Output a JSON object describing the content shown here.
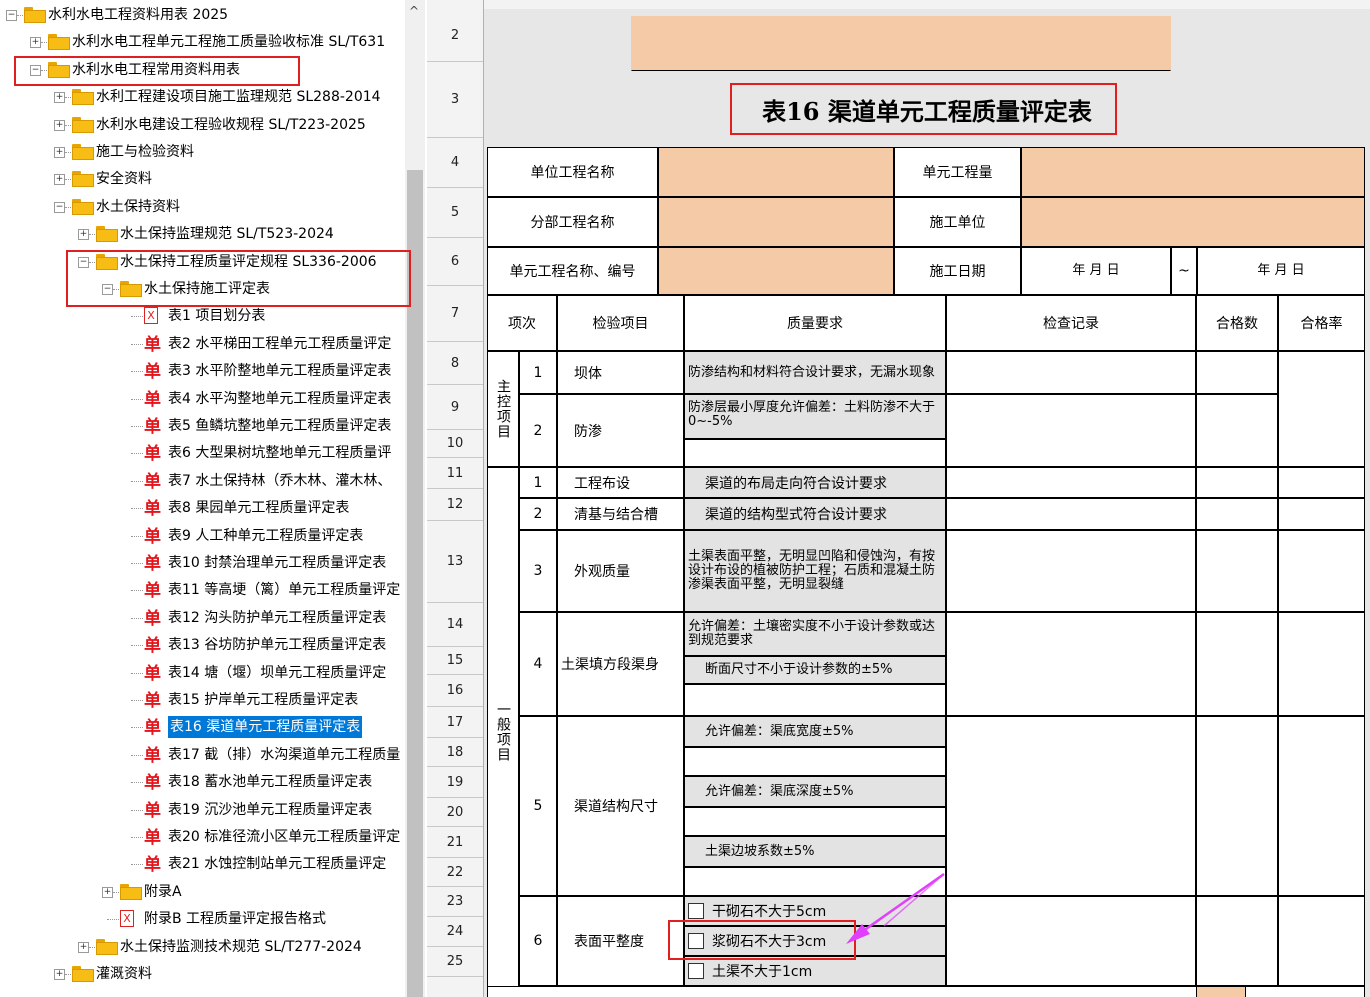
{
  "tree": {
    "items": [
      {
        "label": "水利水电工程资料用表 2025",
        "icon": "folder-icon",
        "expander": "−"
      },
      {
        "label": "水利水电工程单元工程施工质量验收标准 SL/T631",
        "icon": "folder-icon",
        "expander": "+"
      },
      {
        "label": "水利水电工程常用资料用表",
        "icon": "folder-icon",
        "expander": "−"
      },
      {
        "label": "水利工程建设项目施工监理规范 SL288-2014",
        "icon": "folder-icon",
        "expander": "+"
      },
      {
        "label": "水利水电建设工程验收规程 SL/T223-2025",
        "icon": "folder-icon",
        "expander": "+"
      },
      {
        "label": "施工与检验资料",
        "icon": "folder-icon",
        "expander": "+"
      },
      {
        "label": "安全资料",
        "icon": "folder-icon",
        "expander": "+"
      },
      {
        "label": "水土保持资料",
        "icon": "folder-icon",
        "expander": "−"
      },
      {
        "label": "水土保持监理规范 SL/T523-2024",
        "icon": "folder-icon",
        "expander": "+"
      },
      {
        "label": "水土保持工程质量评定规程 SL336-2006",
        "icon": "folder-icon",
        "expander": "−"
      },
      {
        "label": "水土保持施工评定表",
        "icon": "folder-icon",
        "expander": "−"
      },
      {
        "label": "表1 项目划分表",
        "icon": "excel-doc-icon",
        "glyph": "X"
      },
      {
        "label": "表2 水平梯田工程单元工程质量评定",
        "icon": "single-form-icon",
        "glyph": "单"
      },
      {
        "label": "表3 水平阶整地单元工程质量评定表",
        "icon": "single-form-icon",
        "glyph": "单"
      },
      {
        "label": "表4 水平沟整地单元工程质量评定表",
        "icon": "single-form-icon",
        "glyph": "单"
      },
      {
        "label": "表5 鱼鳞坑整地单元工程质量评定表",
        "icon": "single-form-icon",
        "glyph": "单"
      },
      {
        "label": "表6 大型果树坑整地单元工程质量评",
        "icon": "single-form-icon",
        "glyph": "单"
      },
      {
        "label": "表7 水土保持林（乔木林、灌木林、",
        "icon": "single-form-icon",
        "glyph": "单"
      },
      {
        "label": "表8 果园单元工程质量评定表",
        "icon": "single-form-icon",
        "glyph": "单"
      },
      {
        "label": "表9 人工种单元工程质量评定表",
        "icon": "single-form-icon",
        "glyph": "单"
      },
      {
        "label": "表10 封禁治理单元工程质量评定表",
        "icon": "single-form-icon",
        "glyph": "单"
      },
      {
        "label": "表11 等高埂（篱）单元工程质量评定",
        "icon": "single-form-icon",
        "glyph": "单"
      },
      {
        "label": "表12 沟头防护单元工程质量评定表",
        "icon": "single-form-icon",
        "glyph": "单"
      },
      {
        "label": "表13 谷坊防护单元工程质量评定表",
        "icon": "single-form-icon",
        "glyph": "单"
      },
      {
        "label": "表14 塘（堰）坝单元工程质量评定",
        "icon": "single-form-icon",
        "glyph": "单"
      },
      {
        "label": "表15 护岸单元工程质量评定表",
        "icon": "single-form-icon",
        "glyph": "单"
      },
      {
        "label": "表16 渠道单元工程质量评定表",
        "icon": "single-form-icon",
        "glyph": "单",
        "selected": true
      },
      {
        "label": "表17 截（排）水沟渠道单元工程质量",
        "icon": "single-form-icon",
        "glyph": "单"
      },
      {
        "label": "表18 蓄水池单元工程质量评定表",
        "icon": "single-form-icon",
        "glyph": "单"
      },
      {
        "label": "表19 沉沙池单元工程质量评定表",
        "icon": "single-form-icon",
        "glyph": "单"
      },
      {
        "label": "表20 标准径流小区单元工程质量评定",
        "icon": "single-form-icon",
        "glyph": "单"
      },
      {
        "label": "表21 水蚀控制站单元工程质量评定",
        "icon": "single-form-icon",
        "glyph": "单"
      },
      {
        "label": "附录A",
        "icon": "folder-icon",
        "expander": "+"
      },
      {
        "label": "附录B 工程质量评定报告格式",
        "icon": "excel-doc-icon",
        "glyph": "X"
      },
      {
        "label": "水土保持监测技术规范 SL/T277-2024",
        "icon": "folder-icon",
        "expander": "+"
      },
      {
        "label": "灌溉资料",
        "icon": "folder-icon",
        "expander": "+"
      }
    ],
    "scroll_arrow": "^"
  },
  "sheet": {
    "row_numbers": [
      "2",
      "3",
      "4",
      "5",
      "6",
      "7",
      "8",
      "9",
      "10",
      "11",
      "12",
      "13",
      "14",
      "15",
      "16",
      "17",
      "18",
      "19",
      "20",
      "21",
      "22",
      "23",
      "24",
      "25"
    ],
    "title": "表16  渠道单元工程质量评定表",
    "header": {
      "unit_project_name": "单位工程名称",
      "unit_engineering_quantity": "单元工程量",
      "sub_project_name": "分部工程名称",
      "construction_unit": "施工单位",
      "unit_name_number": "单元工程名称、编号",
      "construction_date": "施工日期",
      "date_placeholder": "年    月    日",
      "tilde": "~"
    },
    "columns": {
      "item_no": "项次",
      "inspection_item": "检验项目",
      "quality_requirement": "质量要求",
      "inspection_record": "检查记录",
      "qualified_count": "合格数",
      "qualified_rate": "合格率"
    },
    "main_items_label": "主控项目",
    "general_items_label": "一般项目",
    "rows": {
      "r1_no": "1",
      "r1_item": "坝体",
      "r1_req": "防渗结构和材料符合设计要求，无漏水现象",
      "r2_no": "2",
      "r2_item": "防渗",
      "r2_req": "防渗层最小厚度允许偏差：土料防渗不大于0~-5%",
      "g1_no": "1",
      "g1_item": "工程布设",
      "g1_req": "渠道的布局走向符合设计要求",
      "g2_no": "2",
      "g2_item": "清基与结合槽",
      "g2_req": "渠道的结构型式符合设计要求",
      "g3_no": "3",
      "g3_item": "外观质量",
      "g3_req": "土渠表面平整，无明显凹陷和侵蚀沟，有按设计布设的植被防护工程；石质和混凝土防渗渠表面平整，无明显裂缝",
      "g4_no": "4",
      "g4_item": "土渠填方段渠身",
      "g4_req1": "允许偏差：土壤密实度不小于设计参数或达到规范要求",
      "g4_req2": "断面尺寸不小于设计参数的±5%",
      "g5_no": "5",
      "g5_item": "渠道结构尺寸",
      "g5_req1": "允许偏差：渠底宽度±5%",
      "g5_req2": "允许偏差：渠底深度±5%",
      "g5_req3": "土渠边坡系数±5%",
      "g6_no": "6",
      "g6_item": "表面平整度",
      "g6_opt1": "干砌石不大于5cm",
      "g6_opt2": "浆砌石不大于3cm",
      "g6_opt3": "土渠不大于1cm"
    }
  },
  "colors": {
    "peach": "#f5cba7",
    "annotation_red": "#e02020",
    "annotation_arrow": "#e040fb",
    "selection": "#0078d7"
  }
}
